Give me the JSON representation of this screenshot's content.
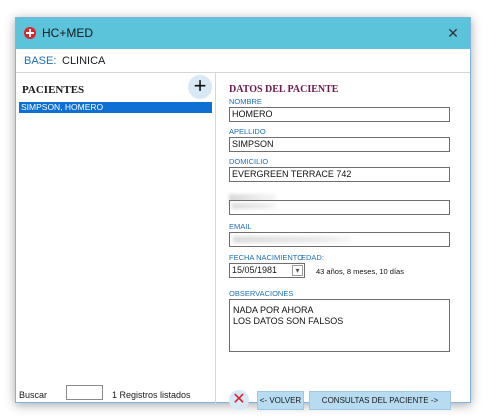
{
  "window": {
    "title": "HC+MED",
    "close_symbol": "✕"
  },
  "base": {
    "label": "BASE:",
    "value": "CLINICA"
  },
  "left": {
    "title": "PACIENTES",
    "add_symbol": "+",
    "patients": [
      "SIMPSON, HOMERO"
    ],
    "search_label": "Buscar",
    "search_value": "",
    "records": "1 Registros listados"
  },
  "form": {
    "title": "DATOS DEL PACIENTE",
    "nombre_label": "NOMBRE",
    "nombre": "HOMERO",
    "apellido_label": "APELLIDO",
    "apellido": "SIMPSON",
    "domicilio_label": "DOMICILIO",
    "domicilio": "EVERGREEN TERRACE 742",
    "email_label": "EMAIL",
    "fecha_label": "FECHA NACIMIENTO",
    "fecha": "15/05/1981",
    "edad_label": "EDAD:",
    "edad": "43 años, 8 meses, 10 días",
    "obs_label": "OBSERVACIONES",
    "obs_line1": "NADA POR AHORA",
    "obs_line2": "LOS DATOS SON FALSOS"
  },
  "actions": {
    "cancel_symbol": "✕",
    "volver": "<- VOLVER",
    "consultas": "CONSULTAS DEL PACIENTE ->"
  },
  "colors": {
    "titlebar": "#5bc3da",
    "label_blue": "#1e6fb8",
    "selection": "#0f6fd3",
    "header_purple": "#6a1a4c",
    "button": "#b7dbf1"
  }
}
